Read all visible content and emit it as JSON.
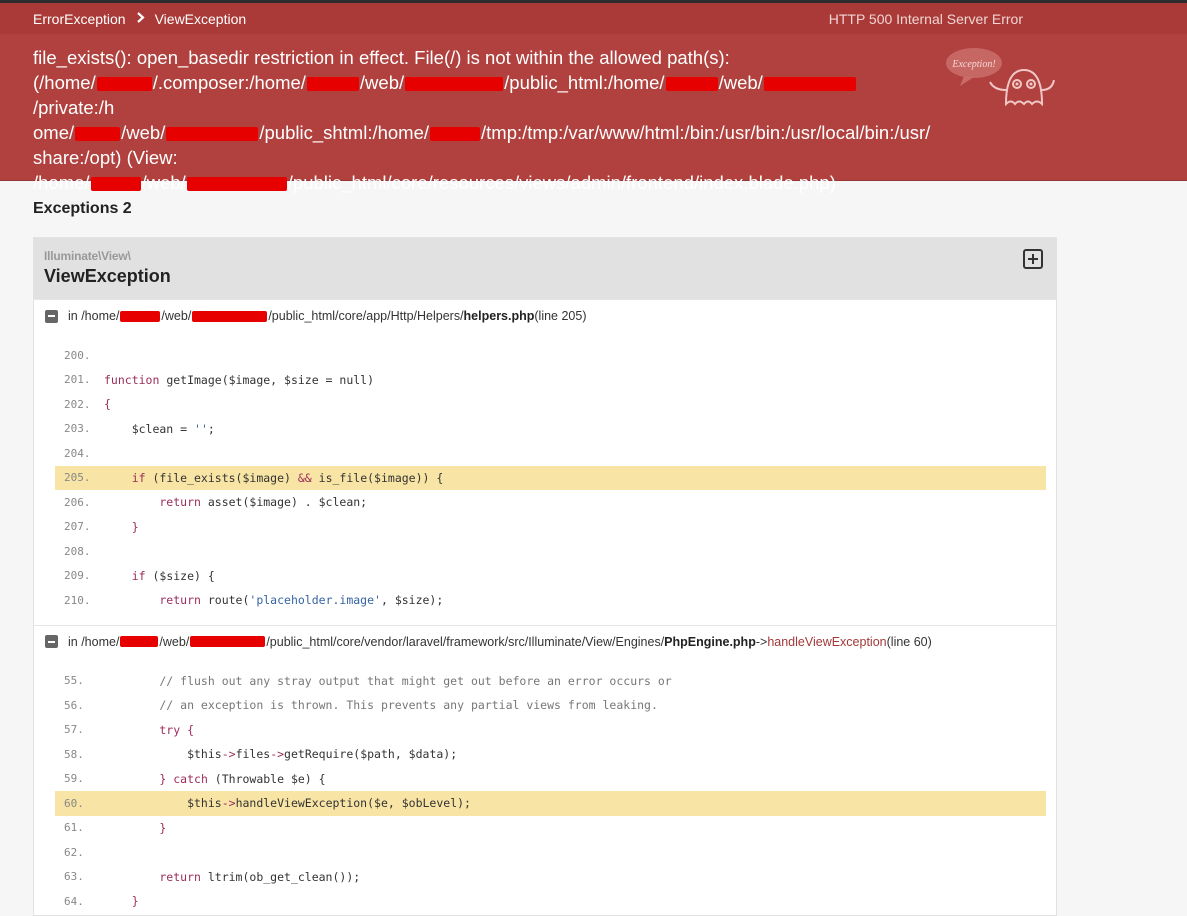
{
  "header": {
    "breadcrumb": [
      "ErrorException",
      "ViewException"
    ],
    "status": "HTTP 500 Internal Server Error",
    "message_parts": {
      "l1": "file_exists(): open_basedir restriction in effect. File(/) is not within the allowed path(s):",
      "l2a": "(/home/",
      "l2b": "/.composer:/home/",
      "l2c": "/web/",
      "l2d": "/public_html:/home/",
      "l2e": "/web/",
      "l2f": "/private:/h",
      "l3a": "ome/",
      "l3b": "/web/",
      "l3c": "/public_shtml:/home/",
      "l3d": "/tmp:/tmp:/var/www/html:/bin:/usr/bin:/usr/local/bin:/usr/",
      "l4": "share:/opt) (View:",
      "l5a": "/home/",
      "l5b": "/web/",
      "l5c": "/public_html/core/resources/views/admin/frontend/index.blade.php)"
    },
    "ghost_label": "Exception!"
  },
  "exceptions_count": "Exceptions 2",
  "panel": {
    "namespace": "Illuminate\\View\\",
    "class_name": "ViewException"
  },
  "traces": [
    {
      "p1": "in /home/",
      "p2": "/web/",
      "p3": "/public_html/core/app/Http/Helpers/",
      "file": "helpers.php",
      "tail": " (line 205)"
    },
    {
      "p1": "in /home/",
      "p2": "/web/",
      "p3": "/public_html/core/vendor/laravel/framework/src/Illuminate/View/Engines/",
      "file": "PhpEngine.php",
      "arrow": " -> ",
      "method": "handleViewException",
      "tail": " (line 60)"
    }
  ],
  "code1": {
    "nums": [
      "200.",
      "201.",
      "202.",
      "203.",
      "204.",
      "205.",
      "206.",
      "207.",
      "208.",
      "209.",
      "210."
    ],
    "l201_fn": "function",
    "l201_rest": " getImage($image, $size = null)",
    "l202": "{",
    "l203_a": "    $clean = ",
    "l203_s": "''",
    "l203_b": ";",
    "l205_if": "    if",
    "l205_rest": " (file_exists($image) ",
    "l205_and": "&&",
    "l205_tail": " is_file($image)) {",
    "l206_ret": "        return",
    "l206_rest": " asset($image) . $clean;",
    "l207": "    }",
    "l209_if": "    if",
    "l209_rest": " ($size) {",
    "l210_ret": "        return",
    "l210_a": " route(",
    "l210_s": "'placeholder.image'",
    "l210_b": ", $size);"
  },
  "code2": {
    "nums": [
      "55.",
      "56.",
      "57.",
      "58.",
      "59.",
      "60.",
      "61.",
      "62.",
      "63.",
      "64."
    ],
    "l55": "        // flush out any stray output that might get out before an error occurs or",
    "l56": "        // an exception is thrown. This prevents any partial views from leaking.",
    "l57_try": "        try",
    "l57_b": " {",
    "l58_a": "            $this",
    "l58_arrow": "->",
    "l58_b": "files",
    "l58_arrow2": "->",
    "l58_c": "getRequire($path, $data);",
    "l59_a": "        } ",
    "l59_catch": "catch",
    "l59_b": " (Throwable $e) {",
    "l60_a": "            $this",
    "l60_arrow": "->",
    "l60_b": "handleViewException($e, $obLevel);",
    "l61": "        }",
    "l63_ret": "        return",
    "l63_b": " ltrim(ob_get_clean());",
    "l64": "    }"
  },
  "colors": {
    "header_bg": "#b0413e",
    "highlight": "#f8e4a4",
    "redaction": "#e60000"
  }
}
